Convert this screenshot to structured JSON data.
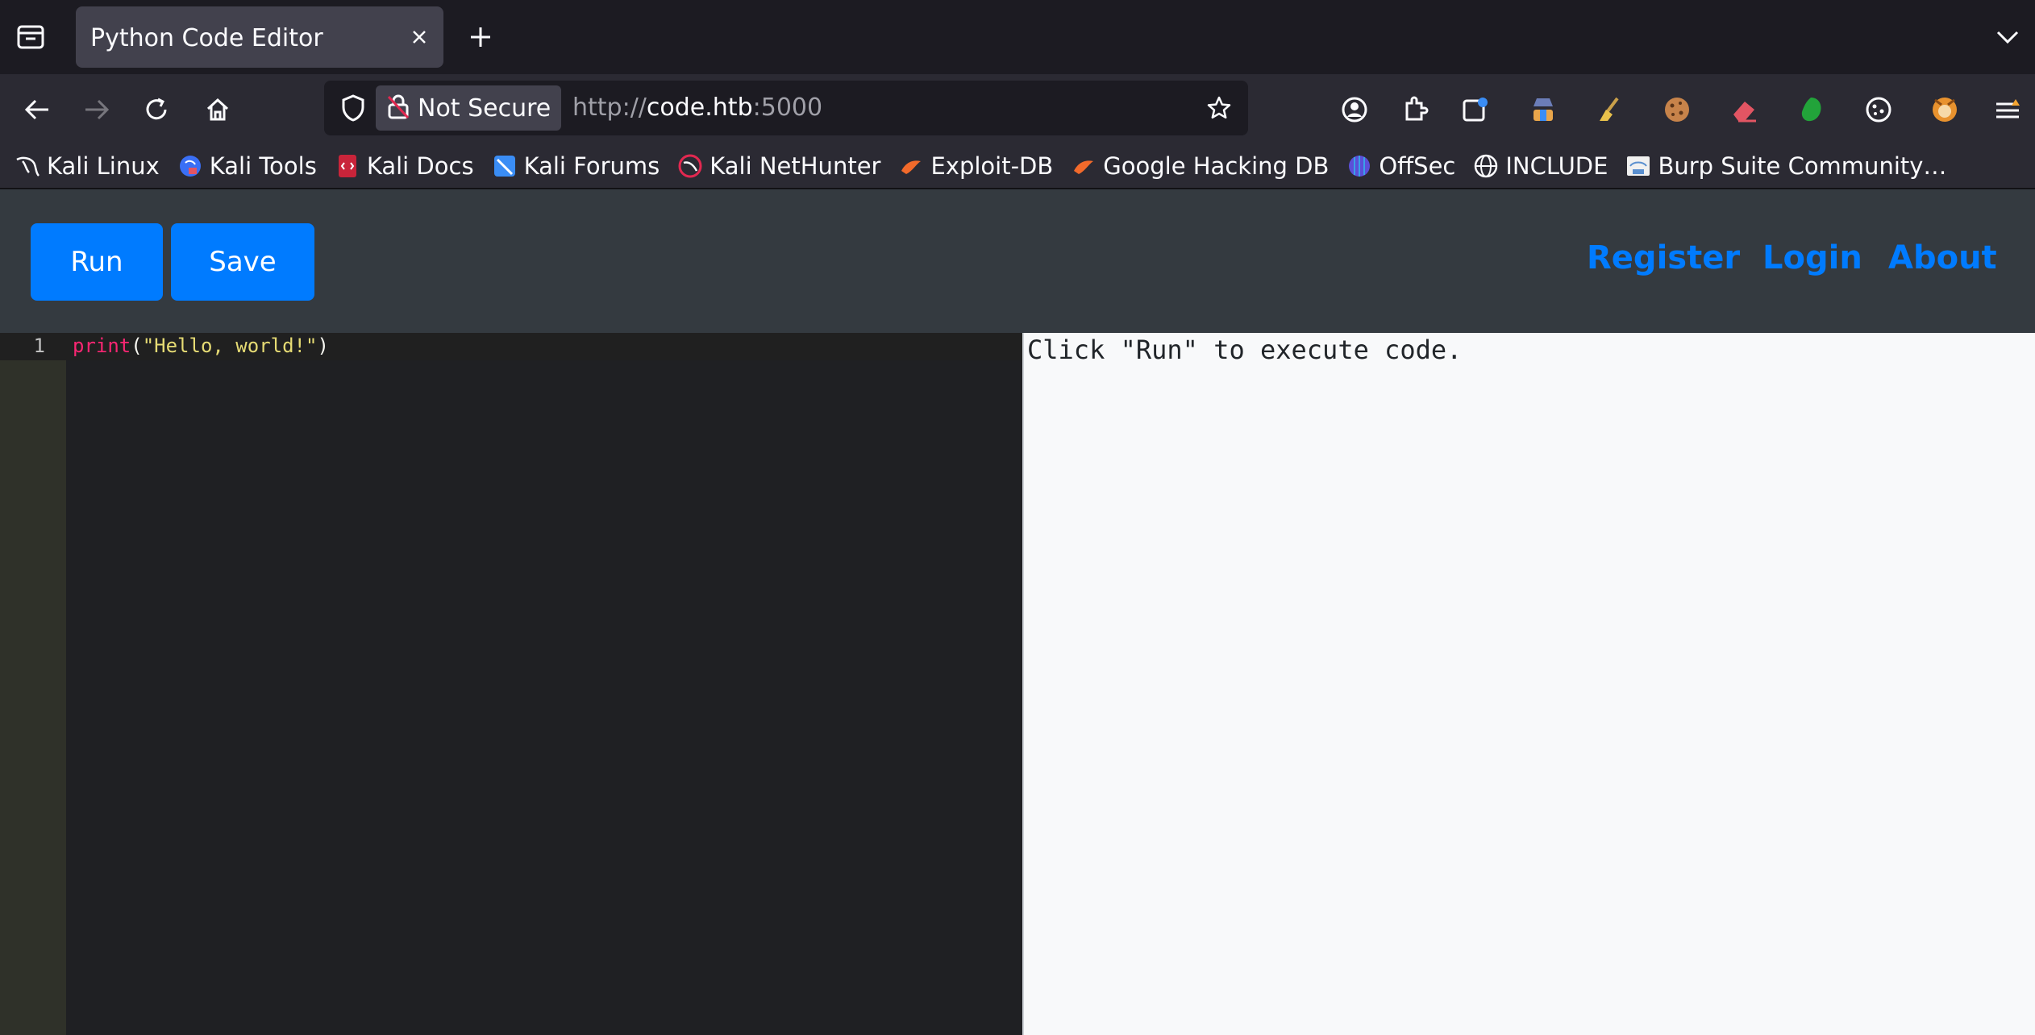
{
  "browser": {
    "tab_title": "Python Code Editor",
    "url_security_label": "Not Secure",
    "url_prefix": "http://",
    "url_host": "code.htb",
    "url_suffix": ":5000"
  },
  "bookmarks": [
    {
      "label": "Kali Linux",
      "icon": "kali-dragon-icon"
    },
    {
      "label": "Kali Tools",
      "icon": "kali-tools-icon"
    },
    {
      "label": "Kali Docs",
      "icon": "kali-docs-icon"
    },
    {
      "label": "Kali Forums",
      "icon": "kali-forums-icon"
    },
    {
      "label": "Kali NetHunter",
      "icon": "kali-nethunter-icon"
    },
    {
      "label": "Exploit-DB",
      "icon": "exploit-db-icon"
    },
    {
      "label": "Google Hacking DB",
      "icon": "google-hacking-db-icon"
    },
    {
      "label": "OffSec",
      "icon": "offsec-icon"
    },
    {
      "label": "INCLUDE",
      "icon": "globe-icon"
    },
    {
      "label": "Burp Suite Community…",
      "icon": "burp-suite-icon"
    }
  ],
  "app": {
    "run_label": "Run",
    "save_label": "Save",
    "nav": {
      "register": "Register",
      "login": "Login",
      "about": "About"
    },
    "accent_color": "#007bff",
    "header_bg": "#343a40"
  },
  "editor": {
    "line_number": "1",
    "code_func": "print",
    "code_open": "(",
    "code_string": "\"Hello, world!\"",
    "code_close": ")"
  },
  "output": {
    "text": "Click \"Run\" to execute code."
  }
}
